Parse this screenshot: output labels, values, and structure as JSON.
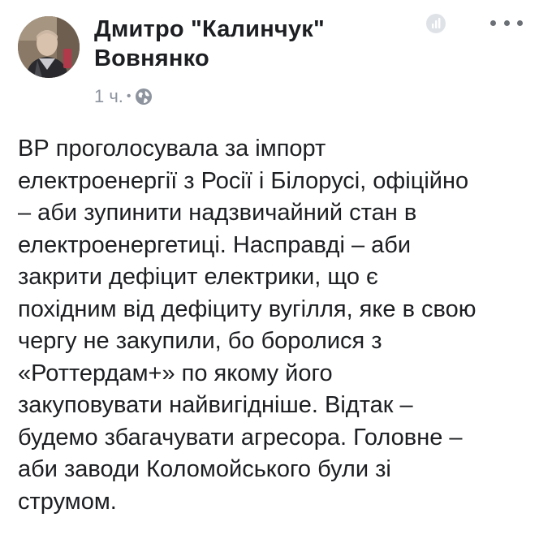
{
  "post": {
    "author": {
      "name_line1": "Дмитро \"Калинчук\"",
      "name_line2": "Вовнянко"
    },
    "time": "1 ч.",
    "separator": "•",
    "privacy_icon": "globe-icon",
    "text_lines": [
      "ВР проголосувала за імпорт",
      "електроенергії з Росії і Білорусі, офіційно",
      "– аби зупинити надзвичайний стан в",
      "електроенергетиці. Насправді – аби",
      "закрити дефіцит електрики, що є",
      "похідним від дефіциту вугілля, яке в свою",
      "чергу не закупили, бо боролися з",
      "«Роттердам+» по якому його",
      "закуповувати найвигідніше. Відтак –",
      "будемо збагачувати агресора. Головне –",
      "аби заводи Коломойського були зі",
      "струмом."
    ]
  },
  "colors": {
    "text": "#1c1e21",
    "meta": "#8d949e",
    "icon": "#6b6f76"
  }
}
